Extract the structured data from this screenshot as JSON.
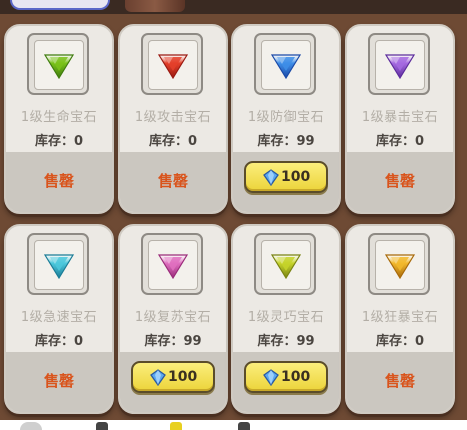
{
  "items": [
    {
      "name": "1级生命宝石",
      "stock": "库存：0",
      "gem_color": "#7ac21a",
      "gem_dark": "#3f7c0e",
      "action": "soldout"
    },
    {
      "name": "1级攻击宝石",
      "stock": "库存：0",
      "gem_color": "#e4402a",
      "gem_dark": "#9a1a12",
      "action": "soldout"
    },
    {
      "name": "1级防御宝石",
      "stock": "库存：99",
      "gem_color": "#3e8ee8",
      "gem_dark": "#1a4aa8",
      "action": "buy"
    },
    {
      "name": "1级暴击宝石",
      "stock": "库存：0",
      "gem_color": "#a56ae0",
      "gem_dark": "#5c2c9c",
      "action": "soldout"
    },
    {
      "name": "1级急速宝石",
      "stock": "库存：0",
      "gem_color": "#4cc8dc",
      "gem_dark": "#1a7c96",
      "action": "soldout"
    },
    {
      "name": "1级复苏宝石",
      "stock": "库存：99",
      "gem_color": "#e070c0",
      "gem_dark": "#9a2c7a",
      "action": "buy"
    },
    {
      "name": "1级灵巧宝石",
      "stock": "库存：99",
      "gem_color": "#c6d42a",
      "gem_dark": "#7a8412",
      "action": "buy"
    },
    {
      "name": "1级狂暴宝石",
      "stock": "库存：0",
      "gem_color": "#f2b82c",
      "gem_dark": "#a86a0a",
      "action": "soldout"
    }
  ],
  "sold_out_label": "售罄",
  "buy_price": "100",
  "icons": {
    "gem": "triangle-gem-icon",
    "currency": "diamond-icon"
  },
  "colors": {
    "background": "#6e4a34",
    "card": "#ece9e4",
    "buy_button": "#f3e25a",
    "sold_out_text": "#d9541c"
  }
}
